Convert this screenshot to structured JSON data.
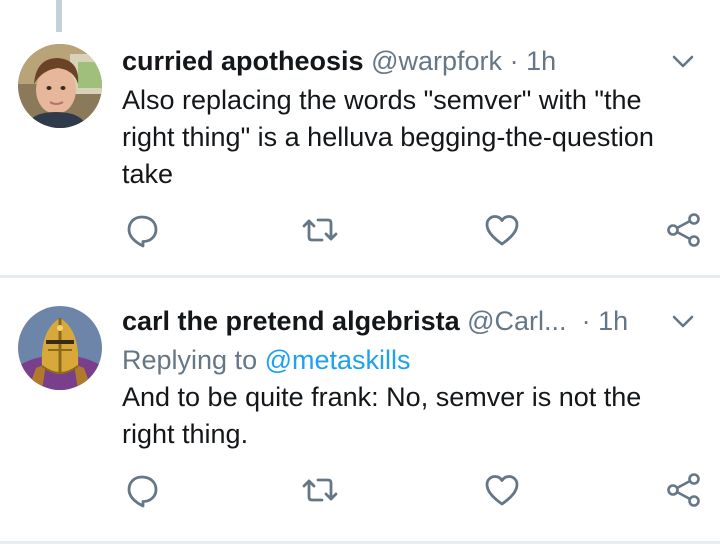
{
  "tweets": [
    {
      "display_name": "curried apotheosis",
      "handle": "@warpfork",
      "separator": "·",
      "time": "1h",
      "text": "Also replacing the words \"semver\" with \"the right thing\" is a helluva begging-the-question take",
      "avatar_icon": "avatar-photo-person"
    },
    {
      "display_name": "carl the pretend algebrista",
      "handle": "@Carl...",
      "separator": "·",
      "time": "1h",
      "replying_label": "Replying to",
      "replying_mention": "@metaskills",
      "text": "And to be quite frank: No, semver is not the right thing.",
      "avatar_icon": "avatar-golden-helmet"
    }
  ],
  "icons": {
    "caret": "chevron-down-icon",
    "reply": "reply-icon",
    "retweet": "retweet-icon",
    "like": "heart-icon",
    "share": "share-icon"
  },
  "colors": {
    "text": "#14171a",
    "secondary": "#657786",
    "accent": "#1da1f2",
    "divider": "#e6ecf0",
    "thread_line": "#c5d0da"
  }
}
